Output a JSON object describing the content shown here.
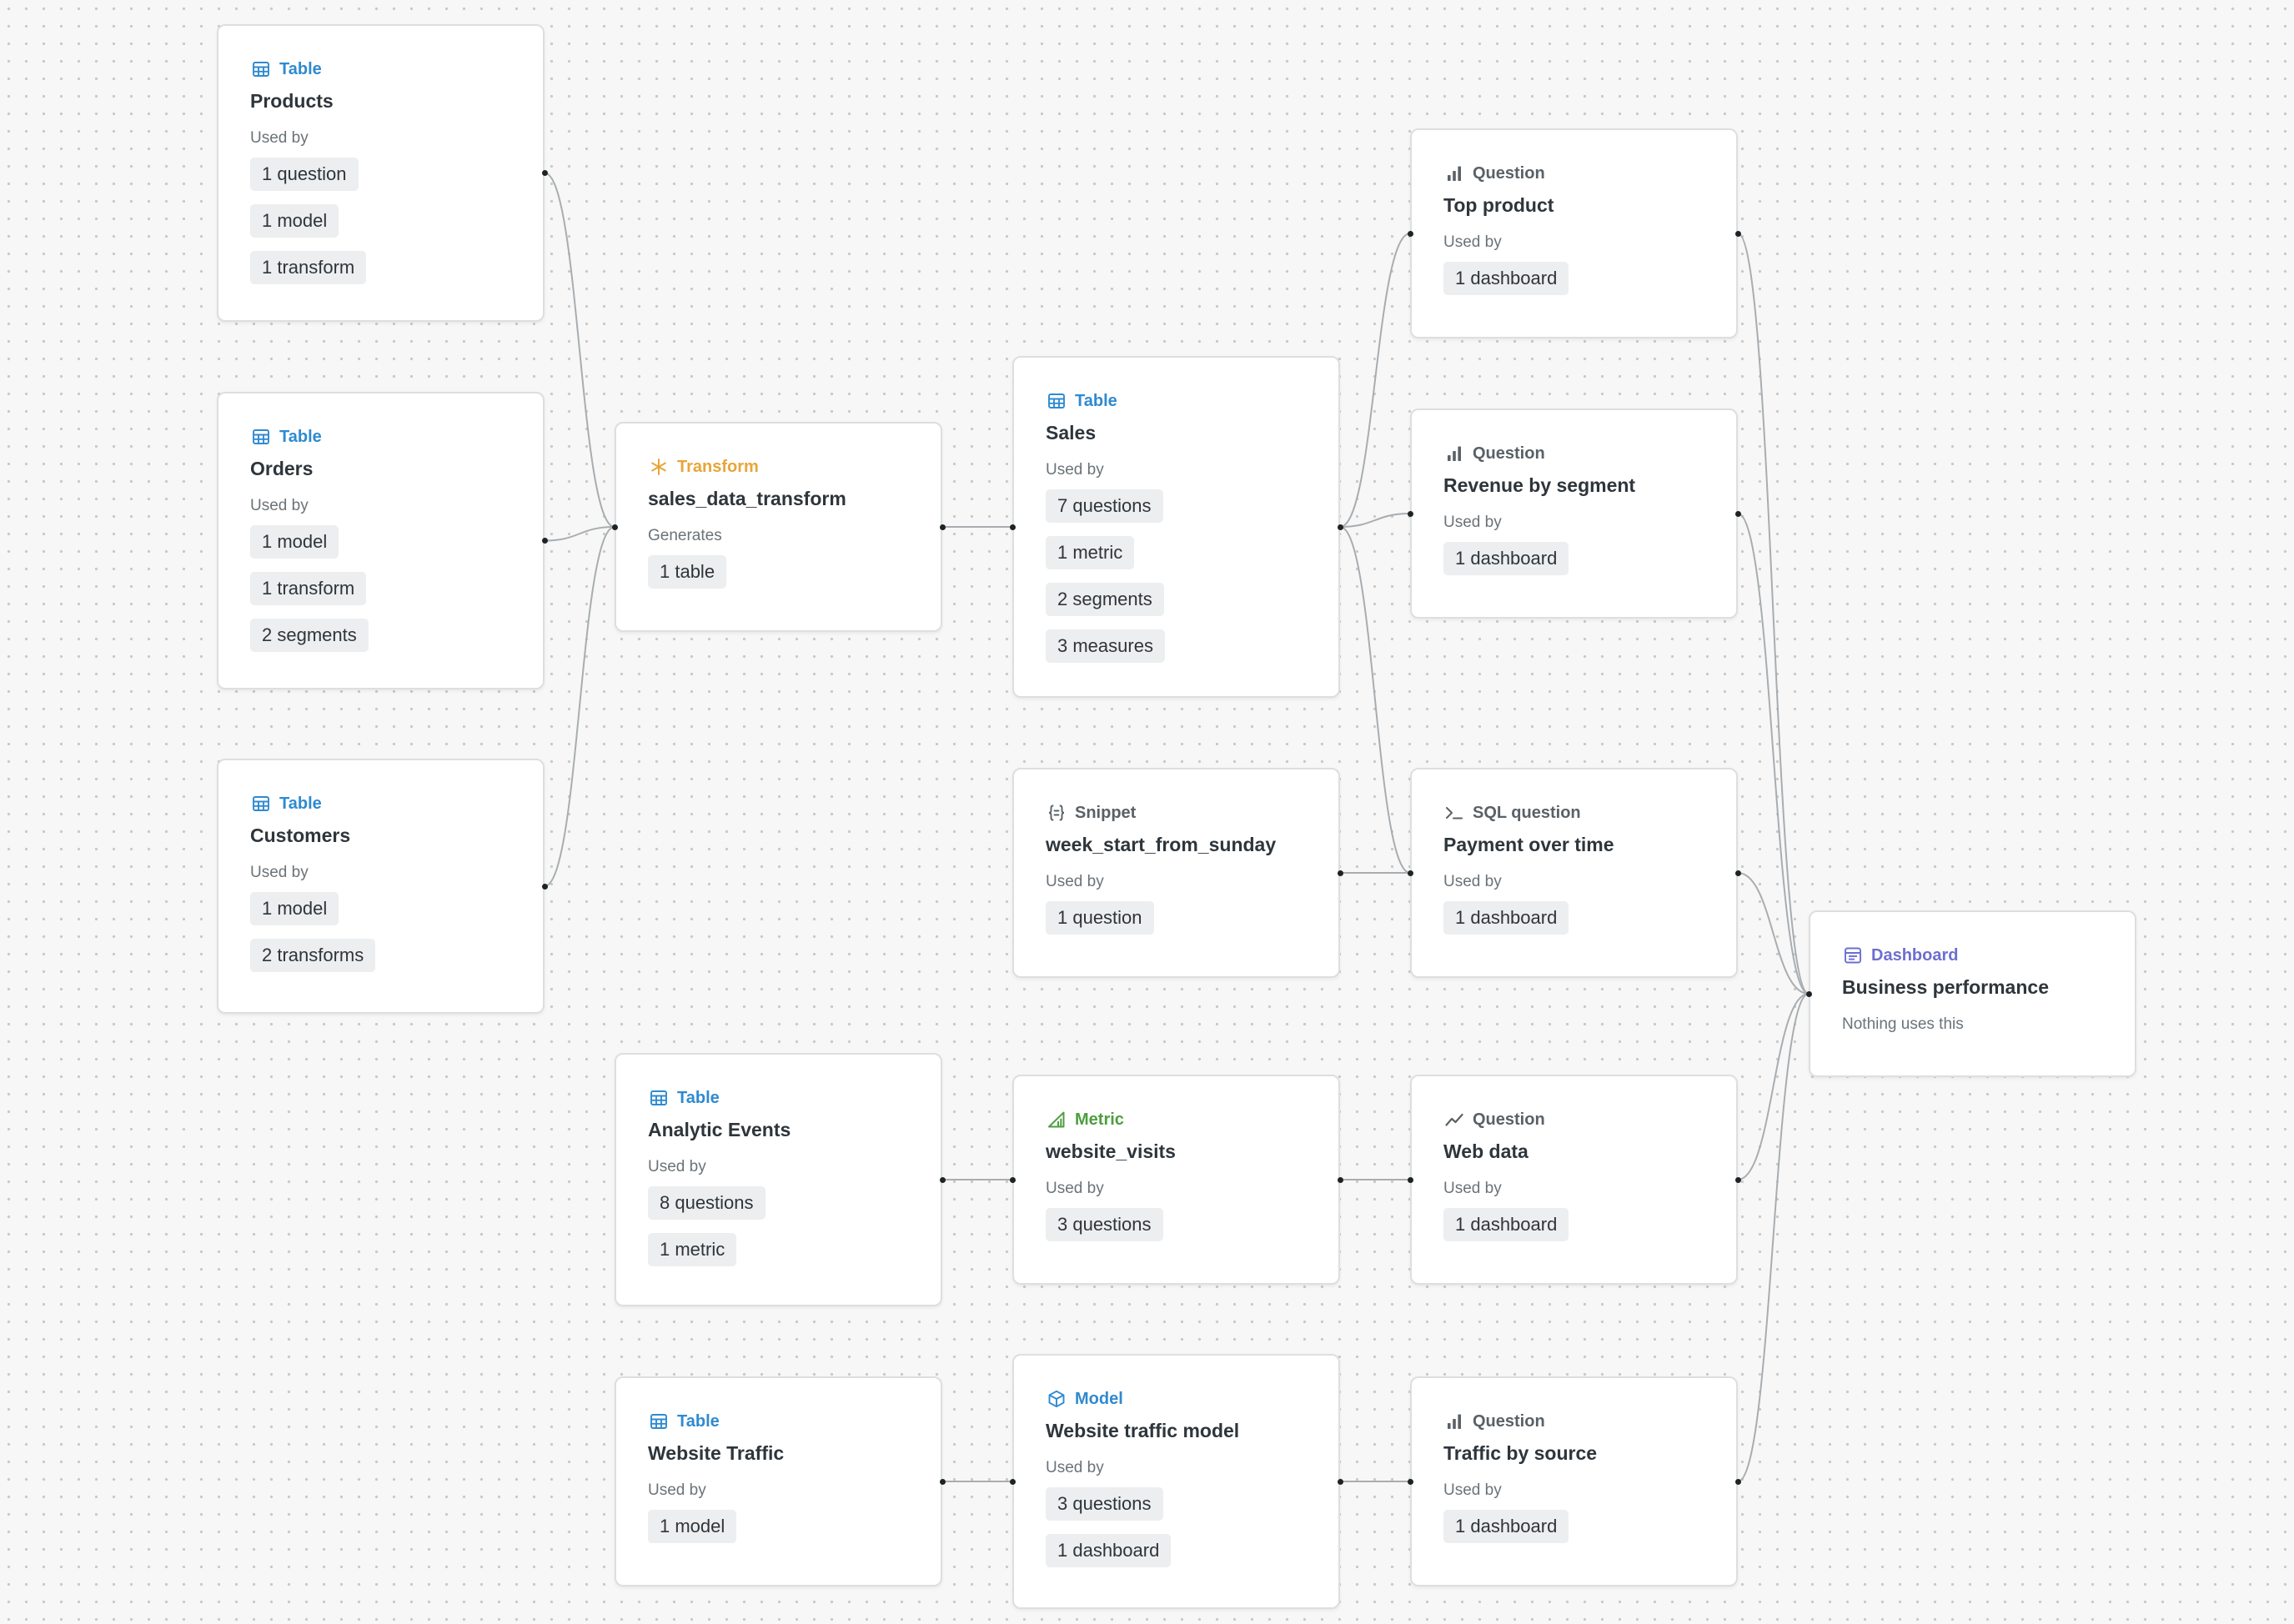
{
  "colors": {
    "table": "#2f8ad0",
    "transform": "#e8a53a",
    "question": "#5a6166",
    "metric": "#4d9e3f",
    "model": "#2f8ad0",
    "dashboard": "#6c6fcf",
    "edge": "#a8adb1"
  },
  "nodes": {
    "products": {
      "type": "Table",
      "icon": "table-icon",
      "title": "Products",
      "section": "Used by",
      "pills": [
        "1 question",
        "1 model",
        "1 transform"
      ]
    },
    "orders": {
      "type": "Table",
      "icon": "table-icon",
      "title": "Orders",
      "section": "Used by",
      "pills": [
        "1 model",
        "1 transform",
        "2 segments"
      ]
    },
    "customers": {
      "type": "Table",
      "icon": "table-icon",
      "title": "Customers",
      "section": "Used by",
      "pills": [
        "1 model",
        "2 transforms"
      ]
    },
    "transform": {
      "type": "Transform",
      "icon": "transform-icon",
      "title": "sales_data_transform",
      "section": "Generates",
      "pills": [
        "1 table"
      ]
    },
    "sales": {
      "type": "Table",
      "icon": "table-icon",
      "title": "Sales",
      "section": "Used by",
      "pills": [
        "7 questions",
        "1 metric",
        "2 segments",
        "3 measures"
      ]
    },
    "snippet": {
      "type": "Snippet",
      "icon": "snippet-icon",
      "title": "week_start_from_sunday",
      "section": "Used by",
      "pills": [
        "1 question"
      ]
    },
    "analytic_events": {
      "type": "Table",
      "icon": "table-icon",
      "title": "Analytic Events",
      "section": "Used by",
      "pills": [
        "8 questions",
        "1 metric"
      ]
    },
    "website_visits": {
      "type": "Metric",
      "icon": "metric-icon",
      "title": "website_visits",
      "section": "Used by",
      "pills": [
        "3 questions"
      ]
    },
    "website_traffic": {
      "type": "Table",
      "icon": "table-icon",
      "title": "Website Traffic",
      "section": "Used by",
      "pills": [
        "1 model"
      ]
    },
    "traffic_model": {
      "type": "Model",
      "icon": "model-cube-icon",
      "title": "Website traffic model",
      "section": "Used by",
      "pills": [
        "3 questions",
        "1 dashboard"
      ]
    },
    "top_product": {
      "type": "Question",
      "icon": "bar-chart-icon",
      "title": "Top product",
      "section": "Used by",
      "pills": [
        "1 dashboard"
      ]
    },
    "revenue_segment": {
      "type": "Question",
      "icon": "bar-chart-icon",
      "title": "Revenue by segment",
      "section": "Used by",
      "pills": [
        "1 dashboard"
      ]
    },
    "payment_time": {
      "type": "SQL question",
      "icon": "sql-prompt-icon",
      "title": "Payment over time",
      "section": "Used by",
      "pills": [
        "1 dashboard"
      ]
    },
    "web_data": {
      "type": "Question",
      "icon": "line-chart-icon",
      "title": "Web data",
      "section": "Used by",
      "pills": [
        "1 dashboard"
      ]
    },
    "traffic_source": {
      "type": "Question",
      "icon": "bar-chart-icon",
      "title": "Traffic by source",
      "section": "Used by",
      "pills": [
        "1 dashboard"
      ]
    },
    "dashboard": {
      "type": "Dashboard",
      "icon": "dashboard-icon",
      "title": "Business performance",
      "section": "Nothing uses this",
      "pills": []
    }
  },
  "edges": [
    [
      "products",
      "transform"
    ],
    [
      "orders",
      "transform"
    ],
    [
      "customers",
      "transform"
    ],
    [
      "transform",
      "sales"
    ],
    [
      "sales",
      "top_product"
    ],
    [
      "sales",
      "revenue_segment"
    ],
    [
      "sales",
      "payment_time"
    ],
    [
      "snippet",
      "payment_time"
    ],
    [
      "analytic_events",
      "website_visits"
    ],
    [
      "website_visits",
      "web_data"
    ],
    [
      "website_traffic",
      "traffic_model"
    ],
    [
      "traffic_model",
      "traffic_source"
    ],
    [
      "top_product",
      "dashboard"
    ],
    [
      "revenue_segment",
      "dashboard"
    ],
    [
      "payment_time",
      "dashboard"
    ],
    [
      "web_data",
      "dashboard"
    ],
    [
      "traffic_source",
      "dashboard"
    ]
  ]
}
